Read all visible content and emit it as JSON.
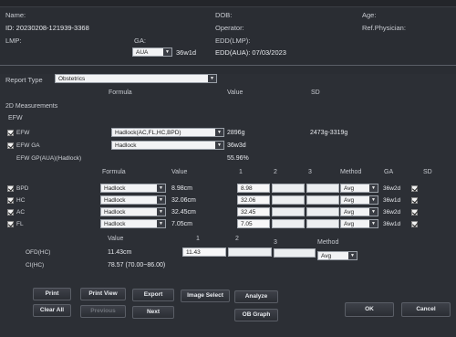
{
  "patient": {
    "name_label": "Name:",
    "id_text": "ID: 20230208-121939-3368",
    "lmp_label": "LMP:",
    "ga_label": "GA:",
    "ga_select": "AUA",
    "ga_value": "36w1d",
    "dob_label": "DOB:",
    "operator_label": "Operator:",
    "edd_lmp_label": "EDD(LMP):",
    "edd_aua_text": "EDD(AUA): 07/03/2023",
    "age_label": "Age:",
    "ref_physician_label": "Ref.Physician:"
  },
  "report_type": {
    "label": "Report Type",
    "value": "Obstetrics"
  },
  "table_header": {
    "formula": "Formula",
    "value": "Value",
    "sd": "SD"
  },
  "section": {
    "title": "2D Measurements",
    "efw_group": "EFW"
  },
  "efw_rows": {
    "efw_label": "EFW",
    "efw_formula": "Hadlock(AC,FL,HC,BPD)",
    "efw_value": "2896g",
    "efw_sd": "2473g-3319g",
    "efw_ga_label": "EFW GA",
    "efw_ga_formula": "Hadlock",
    "efw_ga_value": "36w3d",
    "efw_gp_label": "EFW GP(AUA)(Hadlock)",
    "efw_gp_value": "55.96%"
  },
  "meas_header": {
    "formula": "Formula",
    "value": "Value",
    "c1": "1",
    "c2": "2",
    "c3": "3",
    "method": "Method",
    "ga": "GA",
    "sd": "SD"
  },
  "measurements": [
    {
      "name": "BPD",
      "formula": "Hadlock",
      "value": "8.98cm",
      "m1": "8.98",
      "method": "Avg",
      "ga": "36w2d"
    },
    {
      "name": "HC",
      "formula": "Hadlock",
      "value": "32.06cm",
      "m1": "32.06",
      "method": "Avg",
      "ga": "36w1d"
    },
    {
      "name": "AC",
      "formula": "Hadlock",
      "value": "32.45cm",
      "m1": "32.45",
      "method": "Avg",
      "ga": "36w2d"
    },
    {
      "name": "FL",
      "formula": "Hadlock",
      "value": "7.05cm",
      "m1": "7.05",
      "method": "Avg",
      "ga": "36w1d"
    }
  ],
  "ofd_header": {
    "value": "Value",
    "c1": "1",
    "c2": "2",
    "c3": "3",
    "method": "Method"
  },
  "ofd": {
    "label": "OFD(HC)",
    "value": "11.43cm",
    "m1": "11.43",
    "method": "Avg"
  },
  "ci": {
    "label": "CI(HC)",
    "value": "78.57 (70.00~86.00)"
  },
  "buttons": {
    "print": "Print",
    "print_view": "Print View",
    "export": "Export",
    "image_select": "Image Select",
    "analyze": "Analyze",
    "clear_all": "Clear All",
    "previous": "Previous",
    "next": "Next",
    "ob_graph": "OB Graph",
    "ok": "OK",
    "cancel": "Cancel"
  }
}
